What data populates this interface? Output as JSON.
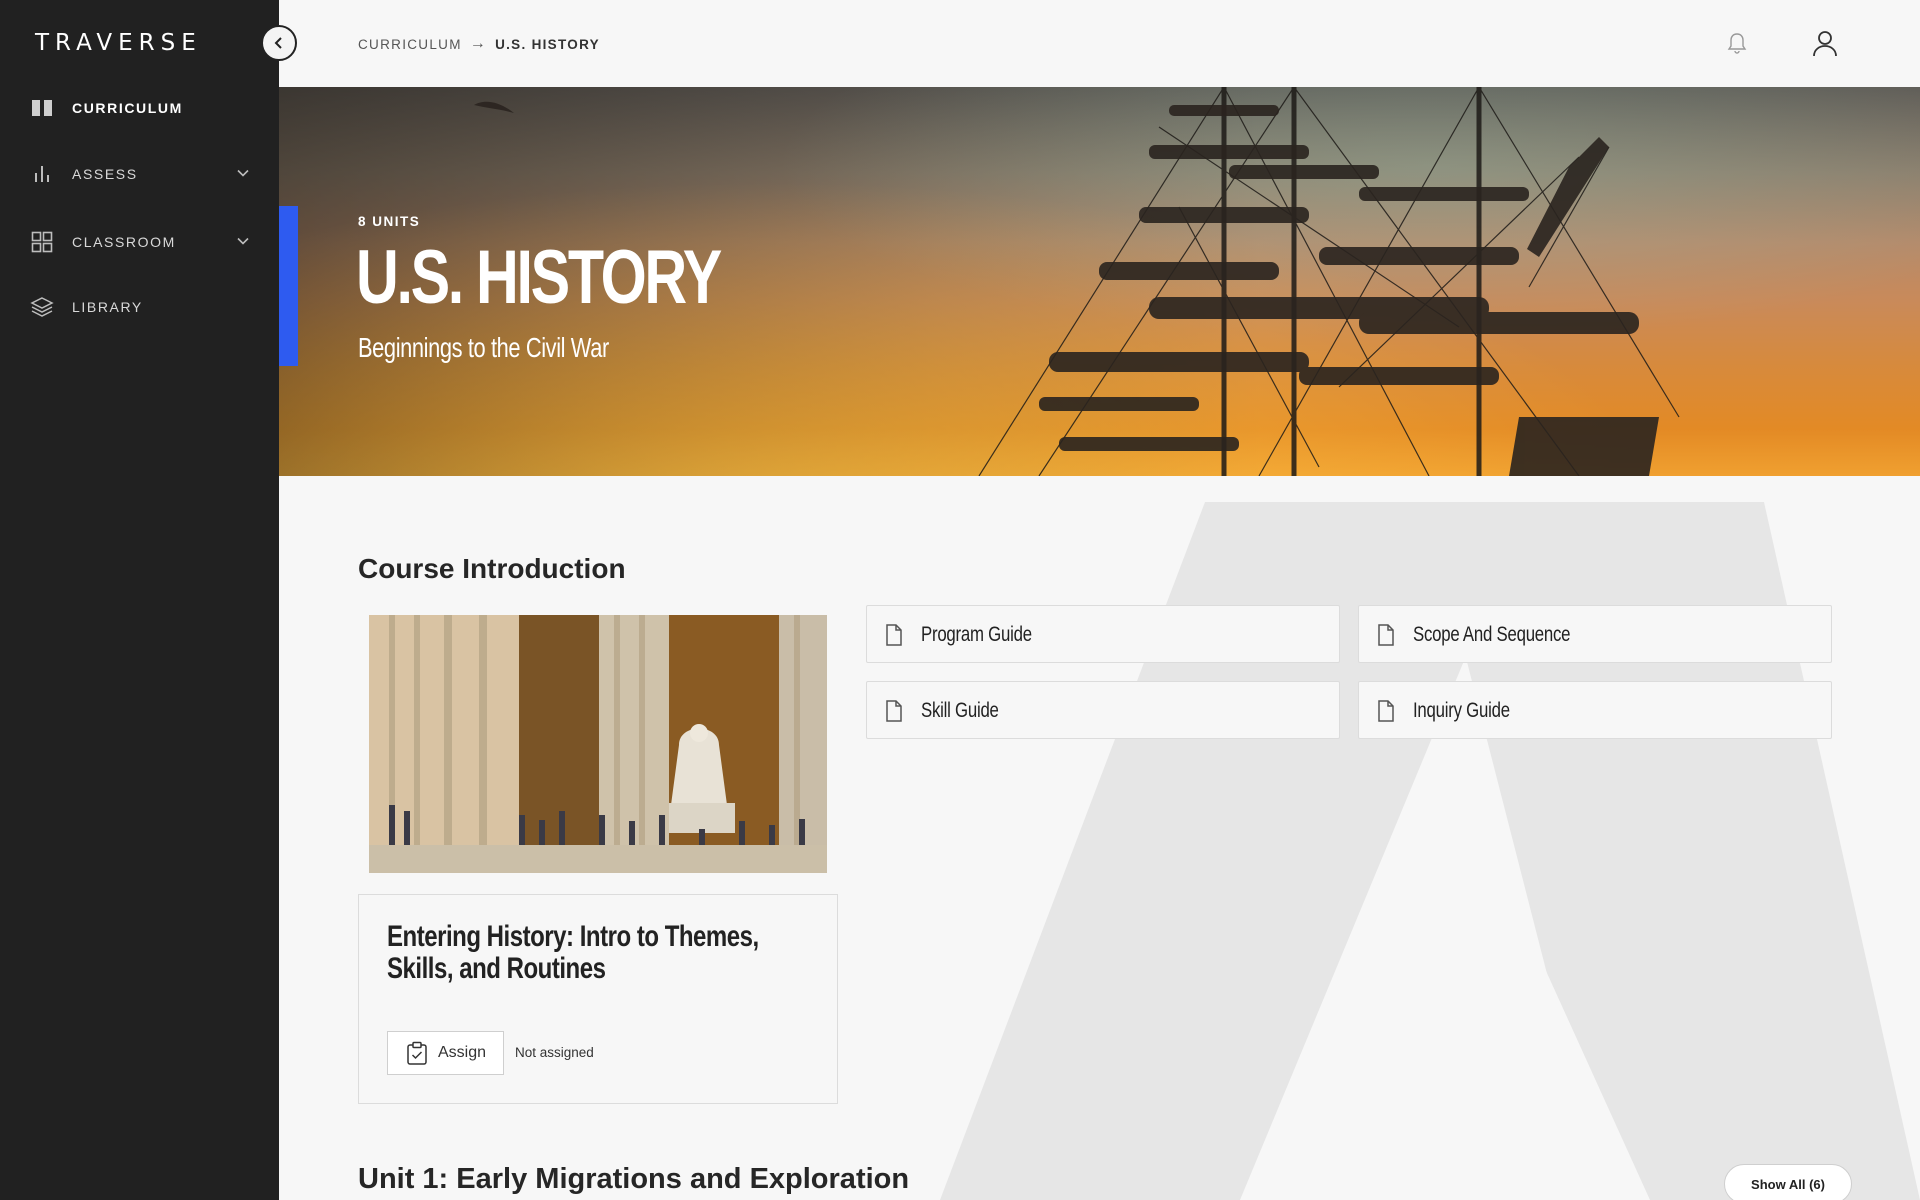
{
  "app": {
    "logo": "TRAVERSE"
  },
  "sidebar": {
    "items": [
      {
        "label": "CURRICULUM",
        "icon": "book-icon",
        "active": true
      },
      {
        "label": "ASSESS",
        "icon": "bar-chart-icon",
        "expandable": true
      },
      {
        "label": "CLASSROOM",
        "icon": "grid-icon",
        "expandable": true
      },
      {
        "label": "LIBRARY",
        "icon": "layers-icon"
      }
    ]
  },
  "header": {
    "breadcrumb": {
      "parent": "CURRICULUM",
      "separator": "→",
      "current": "U.S. HISTORY"
    }
  },
  "hero": {
    "units": "8 UNITS",
    "title": "U.S. HISTORY",
    "subtitle": "Beginnings to the Civil War",
    "accent_color": "#2e5bf0"
  },
  "intro": {
    "section_title": "Course Introduction",
    "card": {
      "title": "Entering History: Intro to Themes, Skills, and Routines",
      "assign_label": "Assign",
      "status": "Not assigned"
    },
    "documents": [
      "Program Guide",
      "Scope And Sequence",
      "Skill Guide",
      "Inquiry Guide"
    ]
  },
  "unit1": {
    "prefix": "Unit 1:",
    "title": "Early Migrations and Exploration",
    "show_all_label": "Show All (6)"
  }
}
